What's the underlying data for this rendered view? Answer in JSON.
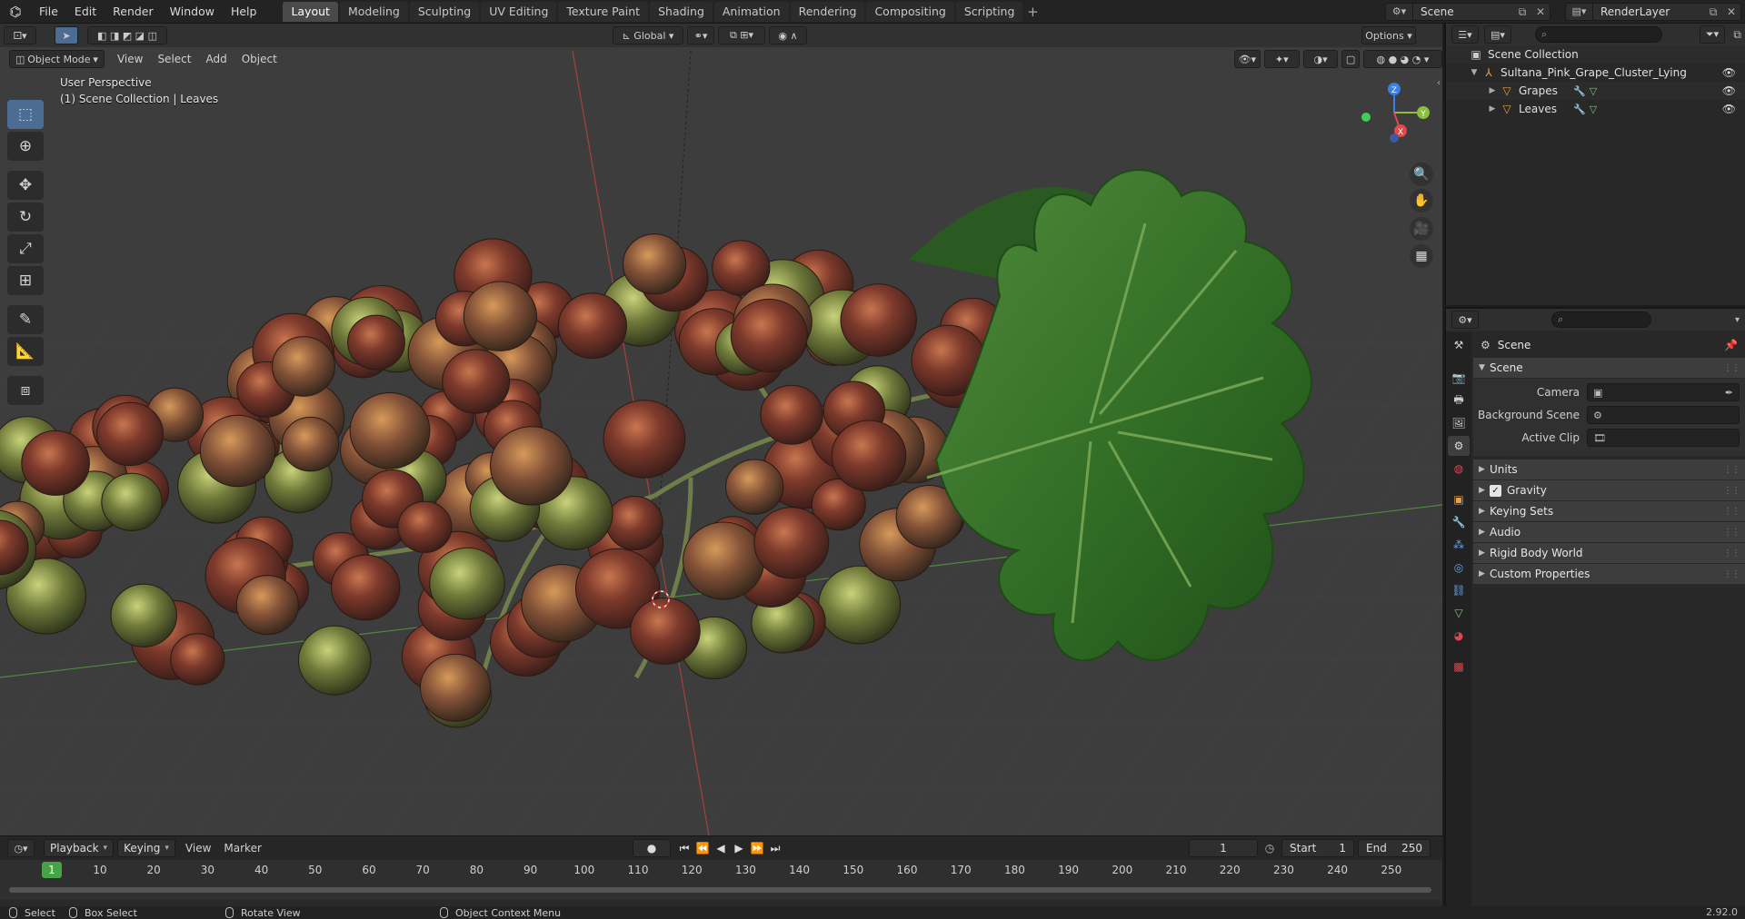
{
  "menu": [
    "File",
    "Edit",
    "Render",
    "Window",
    "Help"
  ],
  "workspaces": [
    "Layout",
    "Modeling",
    "Sculpting",
    "UV Editing",
    "Texture Paint",
    "Shading",
    "Animation",
    "Rendering",
    "Compositing",
    "Scripting"
  ],
  "active_workspace": "Layout",
  "scene_name": "Scene",
  "view_layer": "RenderLayer",
  "viewport": {
    "mode": "Object Mode",
    "menus": [
      "View",
      "Select",
      "Add",
      "Object"
    ],
    "transform_orientation": "Global",
    "options_label": "Options",
    "perspective_label": "User Perspective",
    "collection_label": "(1) Scene Collection | Leaves",
    "gizmo_axes": [
      "Z",
      "Y",
      "X"
    ]
  },
  "timeline": {
    "playback": "Playback",
    "keying": "Keying",
    "view": "View",
    "marker": "Marker",
    "current_frame": "1",
    "start_label": "Start",
    "start": "1",
    "end_label": "End",
    "end": "250",
    "ticks": [
      "10",
      "20",
      "30",
      "40",
      "50",
      "60",
      "70",
      "80",
      "90",
      "100",
      "110",
      "120",
      "130",
      "140",
      "150",
      "160",
      "170",
      "180",
      "190",
      "200",
      "210",
      "220",
      "230",
      "240",
      "250"
    ]
  },
  "status": {
    "select": "Select",
    "box_select": "Box Select",
    "rotate_view": "Rotate View",
    "context_menu": "Object Context Menu",
    "version": "2.92.0"
  },
  "outliner": {
    "root": "Scene Collection",
    "items": [
      {
        "label": "Sultana_Pink_Grape_Cluster_Lying",
        "level": 1
      },
      {
        "label": "Grapes",
        "level": 2
      },
      {
        "label": "Leaves",
        "level": 2
      }
    ]
  },
  "properties": {
    "context": "Scene",
    "panel_scene": "Scene",
    "camera_label": "Camera",
    "background_scene_label": "Background Scene",
    "active_clip_label": "Active Clip",
    "subpanels": [
      "Units",
      "Gravity",
      "Keying Sets",
      "Audio",
      "Rigid Body World",
      "Custom Properties"
    ],
    "gravity_checked": true
  },
  "colors": {
    "accent": "#4b6d94",
    "frame_indicator": "#3b8cf4",
    "axis_x": "#e04a4a",
    "axis_y": "#8bbf3b",
    "axis_z": "#3b7fe0"
  }
}
